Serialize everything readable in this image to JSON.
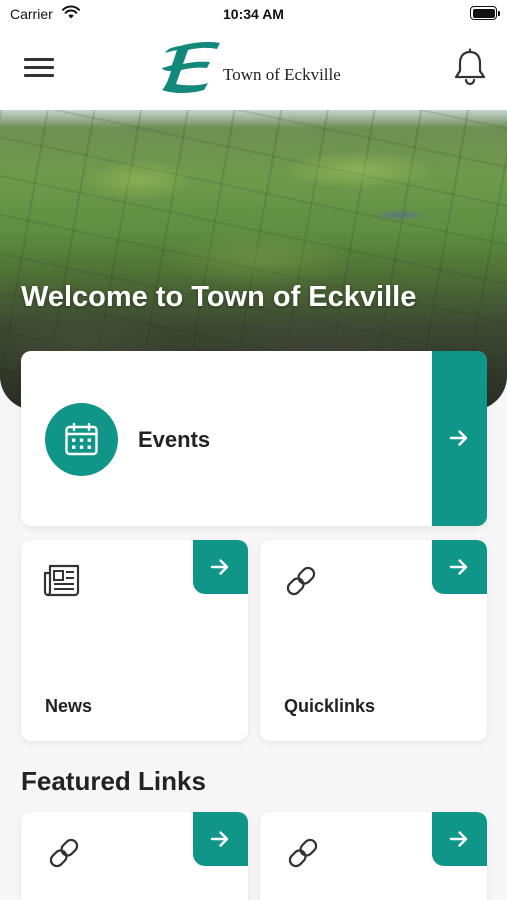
{
  "status_bar": {
    "carrier": "Carrier",
    "time": "10:34 AM",
    "wifi_icon": "wifi-icon",
    "battery_icon": "battery-icon"
  },
  "header": {
    "menu_icon": "hamburger-menu-icon",
    "logo_text": "Town of Eckville",
    "notification_icon": "bell-icon"
  },
  "hero": {
    "title": "Welcome to Town of Eckville"
  },
  "cards": {
    "events": {
      "label": "Events",
      "icon": "calendar-icon",
      "arrow_icon": "arrow-right-icon"
    },
    "news": {
      "label": "News",
      "icon": "newspaper-icon",
      "arrow_icon": "arrow-right-icon"
    },
    "quicklinks": {
      "label": "Quicklinks",
      "icon": "link-icon",
      "arrow_icon": "arrow-right-icon"
    }
  },
  "featured": {
    "title": "Featured Links",
    "items": [
      {
        "label": "",
        "icon": "link-icon",
        "arrow_icon": "arrow-right-icon"
      },
      {
        "label": "",
        "icon": "link-icon",
        "arrow_icon": "arrow-right-icon"
      }
    ]
  },
  "colors": {
    "accent": "#109589",
    "logo": "#13897c",
    "background": "#f7f7f7",
    "card": "#ffffff"
  }
}
